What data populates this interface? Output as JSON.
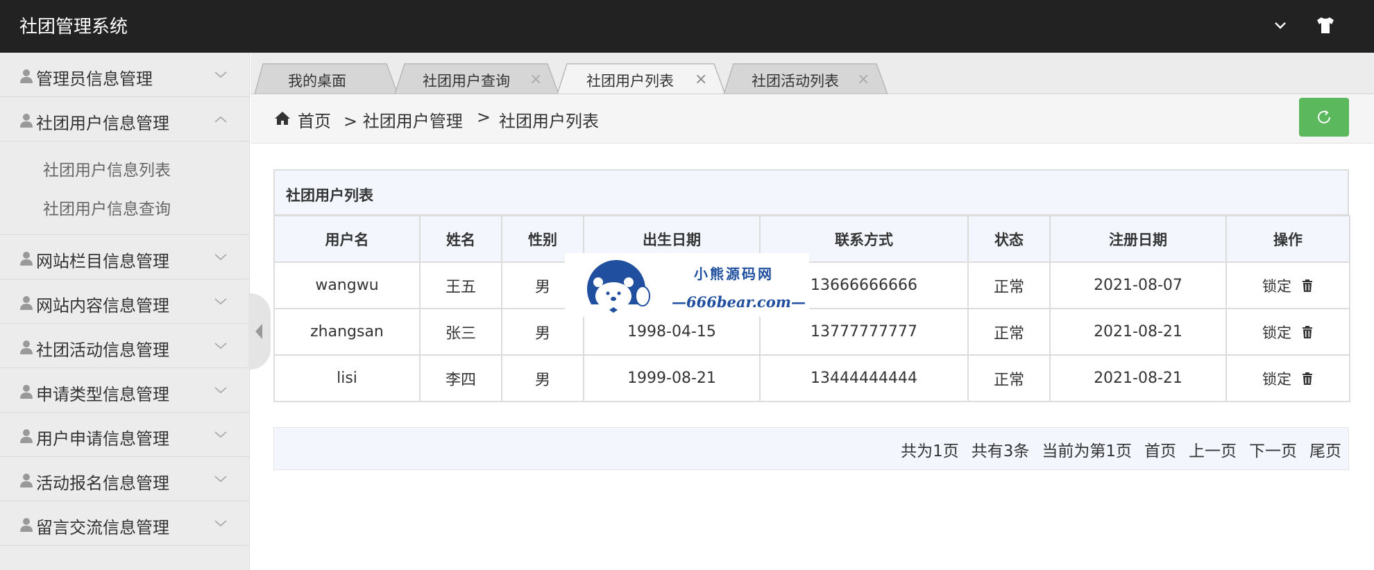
{
  "app": {
    "title": "社团管理系统"
  },
  "header_icons": [
    "chevron-down-icon",
    "tshirt-icon"
  ],
  "sidebar": {
    "items": [
      {
        "label": "管理员信息管理",
        "expanded": false
      },
      {
        "label": "社团用户信息管理",
        "expanded": true,
        "children": [
          "社团用户信息列表",
          "社团用户信息查询"
        ]
      },
      {
        "label": "网站栏目信息管理",
        "expanded": false
      },
      {
        "label": "网站内容信息管理",
        "expanded": false
      },
      {
        "label": "社团活动信息管理",
        "expanded": false
      },
      {
        "label": "申请类型信息管理",
        "expanded": false
      },
      {
        "label": "用户申请信息管理",
        "expanded": false
      },
      {
        "label": "活动报名信息管理",
        "expanded": false
      },
      {
        "label": "留言交流信息管理",
        "expanded": false
      }
    ]
  },
  "tabs": [
    {
      "label": "我的桌面",
      "closable": false,
      "active": false
    },
    {
      "label": "社团用户查询",
      "closable": true,
      "active": false
    },
    {
      "label": "社团用户列表",
      "closable": true,
      "active": true
    },
    {
      "label": "社团活动列表",
      "closable": true,
      "active": false
    }
  ],
  "tab_close_glyph": "×",
  "breadcrumb": {
    "home": "首页",
    "level1": "> 社团用户管理",
    "sep": ">",
    "level2": "社团用户列表"
  },
  "colors": {
    "header_bg": "#222222",
    "refresh_btn": "#5cb85c",
    "table_head_bg": "#f3f7fd",
    "watermark_blue": "#1f4f9e"
  },
  "table": {
    "title": "社团用户列表",
    "columns": [
      "用户名",
      "姓名",
      "性别",
      "出生日期",
      "联系方式",
      "状态",
      "注册日期",
      "操作"
    ],
    "rows": [
      {
        "username": "wangwu",
        "name": "王五",
        "gender": "男",
        "birth": "",
        "phone": "13666666666",
        "status": "正常",
        "reg": "2021-08-07",
        "lock": "锁定"
      },
      {
        "username": "zhangsan",
        "name": "张三",
        "gender": "男",
        "birth": "1998-04-15",
        "phone": "13777777777",
        "status": "正常",
        "reg": "2021-08-21",
        "lock": "锁定"
      },
      {
        "username": "lisi",
        "name": "李四",
        "gender": "男",
        "birth": "1999-08-21",
        "phone": "13444444444",
        "status": "正常",
        "reg": "2021-08-21",
        "lock": "锁定"
      }
    ]
  },
  "watermark": {
    "line1": "小熊源码网",
    "line2": "—666bear.com—"
  },
  "pager": {
    "total_pages": "共为1页",
    "total_items": "共有3条",
    "current": "当前为第1页",
    "first": "首页",
    "prev": "上一页",
    "next": "下一页",
    "last": "尾页"
  }
}
